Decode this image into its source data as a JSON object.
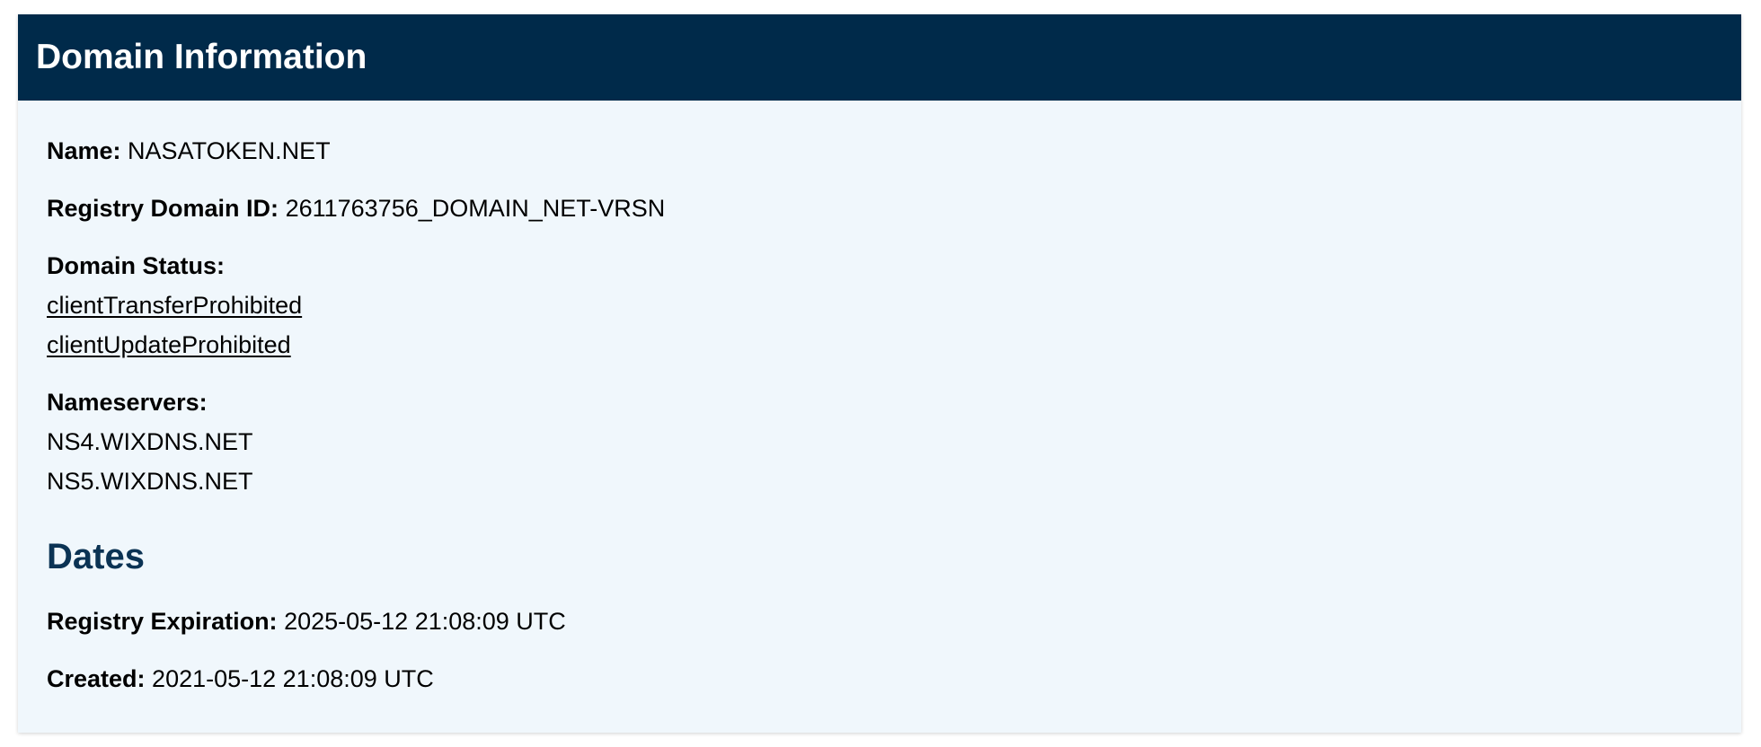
{
  "panel": {
    "title": "Domain Information"
  },
  "domain": {
    "name_label": "Name:",
    "name_value": "NASATOKEN.NET",
    "registry_id_label": "Registry Domain ID:",
    "registry_id_value": "2611763756_DOMAIN_NET-VRSN",
    "status_label": "Domain Status:",
    "statuses": [
      "clientTransferProhibited",
      "clientUpdateProhibited"
    ],
    "nameservers_label": "Nameservers:",
    "nameservers": [
      "NS4.WIXDNS.NET",
      "NS5.WIXDNS.NET"
    ]
  },
  "dates": {
    "heading": "Dates",
    "expiration_label": "Registry Expiration:",
    "expiration_value": "2025-05-12 21:08:09 UTC",
    "created_label": "Created:",
    "created_value": "2021-05-12 21:08:09 UTC"
  },
  "colors": {
    "header_bg": "#002a4a",
    "panel_bg": "#f0f7fc",
    "link": "#0b2f52",
    "section_heading": "#0b3354"
  }
}
